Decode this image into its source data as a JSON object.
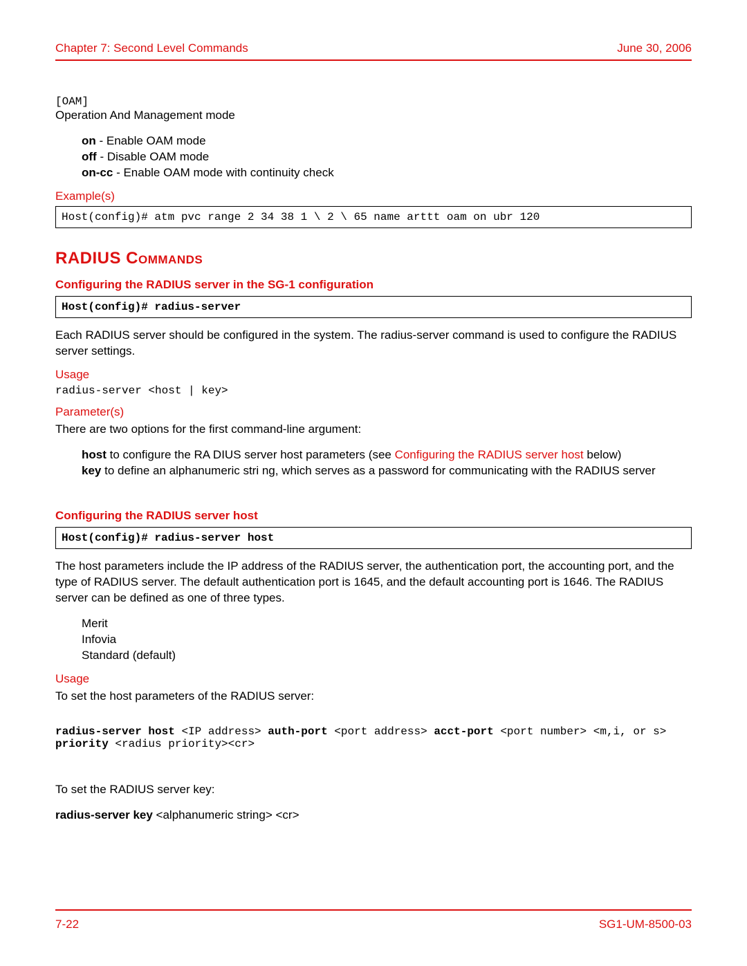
{
  "header": {
    "left": "Chapter 7: Second Level Commands",
    "right": "June 30, 2006"
  },
  "footer": {
    "left": "7-22",
    "right": "SG1-UM-8500-03"
  },
  "oam": {
    "tag": "[OAM]",
    "desc": "Operation And Management mode",
    "opts": {
      "on_bold": "on",
      "on_text": " - Enable OAM mode",
      "off_bold": "off",
      "off_text": " - Disable OAM mode",
      "oncc_bold": "on-cc",
      "oncc_text": " - Enable OAM mode with continuity check"
    }
  },
  "example": {
    "label": "Example(s)",
    "code": "Host(config)# atm pvc range 2 34 38 1 \\ 2 \\ 65 name arttt oam on ubr 120"
  },
  "radius": {
    "title": "RADIUS Commands",
    "sub1": "Configuring the RADIUS server in the SG-1 configuration",
    "cmd1": "Host(config)# radius-server",
    "desc1": "Each RADIUS server should be configured in the system. The radius-server command is used to configure the RADIUS server settings.",
    "usage_label": "Usage",
    "usage1": "radius-server <host | key>",
    "params_label": "Parameter(s)",
    "params_intro": "There are two options for the first command-line argument:",
    "host_bold": "host",
    "host_text1": " to configure the RA DIUS server host parameters (see  ",
    "host_link": "Configuring the RADIUS server host",
    "host_text2": "  below)",
    "key_bold": "key",
    "key_text": " to define an alphanumeric stri ng, which serves as a password for communicating with the RADIUS server",
    "sub2": "Configuring the RADIUS server host",
    "cmd2": "Host(config)# radius-server host",
    "desc2": "The host parameters include the IP address of the RADIUS server, the authentication port, the accounting port, and the type of RADIUS server. The default authentication port is 1645, and the default accounting port is 1646. The RADIUS server can be defined as one of three types.",
    "types": {
      "t1": "Merit",
      "t2": "Infovia",
      "t3": "Standard (default)"
    },
    "usage2_intro": "To set the host parameters of the RADIUS server:",
    "usage2_syntax": {
      "p1": "radius-server host ",
      "p2": "<IP address> ",
      "p3": "auth-port ",
      "p4": "<port address> ",
      "p5": "acct-port ",
      "p6": "<port number> <m,i, or s> ",
      "p7": "priority ",
      "p8": "<radius priority><cr>"
    },
    "key_intro": "To set the RADIUS server key:",
    "key_syntax_bold": "radius-server key",
    "key_syntax_rest": " <alphanumeric string> <cr>"
  }
}
